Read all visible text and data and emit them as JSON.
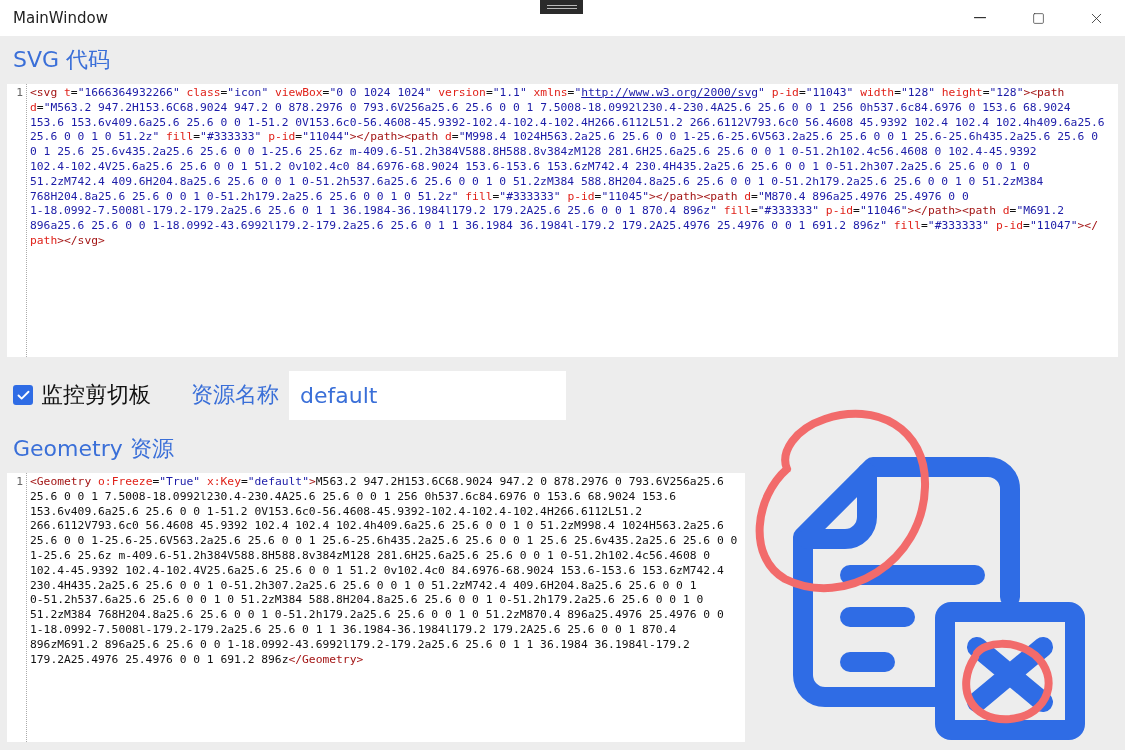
{
  "window": {
    "title": "MainWindow"
  },
  "svg_section": {
    "heading": "SVG 代码",
    "line_number": "1",
    "code_lines": [
      "<svg t=\"1666364932266\" class=\"icon\" viewBox=\"0 0 1024 1024\" version=\"1.1\" xmlns=\"http://www.w3.org/2000/svg\" p-id=\"11043\" width=\"128\" height=\"128\"><path",
      "d=\"M563.2 947.2H153.6C68.9024 947.2 0 878.2976 0 793.6V256a25.6 25.6 0 0 1 7.5008-18.0992l230.4-230.4A25.6 25.6 0 0 1 256 0h537.6c84.6976 0 153.6 68.9024",
      "153.6 153.6v409.6a25.6 25.6 0 0 1-51.2 0V153.6c0-56.4608-45.9392-102.4-102.4-102.4H266.6112L51.2 266.6112V793.6c0 56.4608 45.9392 102.4 102.4 102.4h409.6a25.6",
      "25.6 0 0 1 0 51.2z\" fill=\"#333333\" p-id=\"11044\"></path><path d=\"M998.4 1024H563.2a25.6 25.6 0 0 1-25.6-25.6V563.2a25.6 25.6 0 0 1 25.6-25.6h435.2a25.6 25.6 0",
      "0 1 25.6 25.6v435.2a25.6 25.6 0 0 1-25.6 25.6z m-409.6-51.2h384V588.8H588.8v384zM128 281.6H25.6a25.6 25.6 0 0 1 0-51.2h102.4c56.4608 0 102.4-45.9392",
      "102.4-102.4V25.6a25.6 25.6 0 0 1 51.2 0v102.4c0 84.6976-68.9024 153.6-153.6 153.6zM742.4 230.4H435.2a25.6 25.6 0 0 1 0-51.2h307.2a25.6 25.6 0 0 1 0",
      "51.2zM742.4 409.6H204.8a25.6 25.6 0 0 1 0-51.2h537.6a25.6 25.6 0 0 1 0 51.2zM384 588.8H204.8a25.6 25.6 0 0 1 0-51.2h179.2a25.6 25.6 0 0 1 0 51.2zM384",
      "768H204.8a25.6 25.6 0 0 1 0-51.2h179.2a25.6 25.6 0 0 1 0 51.2z\" fill=\"#333333\" p-id=\"11045\"></path><path d=\"M870.4 896a25.4976 25.4976 0 0",
      "1-18.0992-7.5008l-179.2-179.2a25.6 25.6 0 1 1 36.1984-36.1984l179.2 179.2A25.6 25.6 0 0 1 870.4 896z\" fill=\"#333333\" p-id=\"11046\"></path><path d=\"M691.2",
      "896a25.6 25.6 0 0 1-18.0992-43.6992l179.2-179.2a25.6 25.6 0 1 1 36.1984 36.1984l-179.2 179.2A25.4976 25.4976 0 0 1 691.2 896z\" fill=\"#333333\" p-id=\"11047\"></",
      "path></svg>"
    ]
  },
  "options": {
    "monitor_clipboard": {
      "label": "监控剪切板",
      "checked": true
    },
    "resource_name": {
      "label": "资源名称",
      "value": "default"
    }
  },
  "geometry_section": {
    "heading": "Geometry 资源",
    "line_number": "1",
    "code_lines": [
      "<Geometry o:Freeze=\"True\" x:Key=\"default\">M563.2 947.2H153.6C68.9024 947.2 0 878.2976 0 793.6V256a25.6",
      "25.6 0 0 1 7.5008-18.0992l230.4-230.4A25.6 25.6 0 0 1 256 0h537.6c84.6976 0 153.6 68.9024 153.6",
      "153.6v409.6a25.6 25.6 0 0 1-51.2 0V153.6c0-56.4608-45.9392-102.4-102.4-102.4H266.6112L51.2",
      "266.6112V793.6c0 56.4608 45.9392 102.4 102.4 102.4h409.6a25.6 25.6 0 0 1 0 51.2zM998.4 1024H563.2a25.6",
      "25.6 0 0 1-25.6-25.6V563.2a25.6 25.6 0 0 1 25.6-25.6h435.2a25.6 25.6 0 0 1 25.6 25.6v435.2a25.6 25.6 0 0",
      "1-25.6 25.6z m-409.6-51.2h384V588.8H588.8v384zM128 281.6H25.6a25.6 25.6 0 0 1 0-51.2h102.4c56.4608 0",
      "102.4-45.9392 102.4-102.4V25.6a25.6 25.6 0 0 1 51.2 0v102.4c0 84.6976-68.9024 153.6-153.6 153.6zM742.4",
      "230.4H435.2a25.6 25.6 0 0 1 0-51.2h307.2a25.6 25.6 0 0 1 0 51.2zM742.4 409.6H204.8a25.6 25.6 0 0 1",
      "0-51.2h537.6a25.6 25.6 0 0 1 0 51.2zM384 588.8H204.8a25.6 25.6 0 0 1 0-51.2h179.2a25.6 25.6 0 0 1 0",
      "51.2zM384 768H204.8a25.6 25.6 0 0 1 0-51.2h179.2a25.6 25.6 0 0 1 0 51.2zM870.4 896a25.4976 25.4976 0 0",
      "1-18.0992-7.5008l-179.2-179.2a25.6 25.6 0 1 1 36.1984-36.1984l179.2 179.2A25.6 25.6 0 0 1 870.4",
      "896zM691.2 896a25.6 25.6 0 0 1-18.0992-43.6992l179.2-179.2a25.6 25.6 0 1 1 36.1984 36.1984l-179.2",
      "179.2A25.4976 25.4976 0 0 1 691.2 896z</Geometry>"
    ]
  }
}
